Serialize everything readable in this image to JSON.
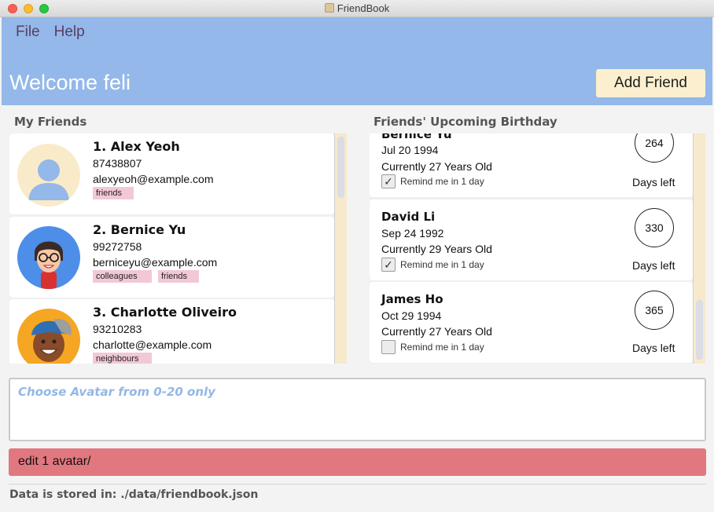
{
  "window": {
    "title": "FriendBook"
  },
  "menu": {
    "file": "File",
    "help": "Help"
  },
  "header": {
    "welcome": "Welcome feli",
    "add_friend_label": "Add Friend"
  },
  "friends": {
    "title": "My Friends",
    "items": [
      {
        "index_name": "1.  Alex Yeoh",
        "phone": "87438807",
        "email": "alexyeoh@example.com",
        "tags": [
          "friends"
        ],
        "avatar": "default-avatar"
      },
      {
        "index_name": "2.  Bernice Yu",
        "phone": "99272758",
        "email": "berniceyu@example.com",
        "tags": [
          "colleagues",
          "friends"
        ],
        "avatar": "glasses-girl-avatar"
      },
      {
        "index_name": "3.  Charlotte Oliveiro",
        "phone": "93210283",
        "email": "charlotte@example.com",
        "tags": [
          "neighbours"
        ],
        "avatar": "cap-boy-avatar"
      }
    ]
  },
  "birthdays": {
    "title": "Friends' Upcoming Birthday",
    "items": [
      {
        "name": "Bernice Yu",
        "date": "Jul 20 1994",
        "age": "Currently 27 Years Old",
        "remind": "Remind me in 1 day",
        "checked": true,
        "days": "264",
        "days_label": "Days left"
      },
      {
        "name": "David Li",
        "date": "Sep 24 1992",
        "age": "Currently 29 Years Old",
        "remind": "Remind me in 1 day",
        "checked": true,
        "days": "330",
        "days_label": "Days left"
      },
      {
        "name": "James Ho",
        "date": "Oct 29 1994",
        "age": "Currently 27 Years Old",
        "remind": "Remind me in 1 day",
        "checked": false,
        "days": "365",
        "days_label": "Days left"
      }
    ]
  },
  "result": {
    "message": "Choose Avatar from 0-20 only"
  },
  "command": {
    "value": "edit 1 avatar/"
  },
  "status": {
    "text": "Data is stored in: ./data/friendbook.json"
  },
  "colors": {
    "header": "#93b8e9",
    "add_button": "#fcefcf",
    "tag": "#f3c8d6",
    "command_error": "#e1777f",
    "result_text": "#94b7e6"
  }
}
